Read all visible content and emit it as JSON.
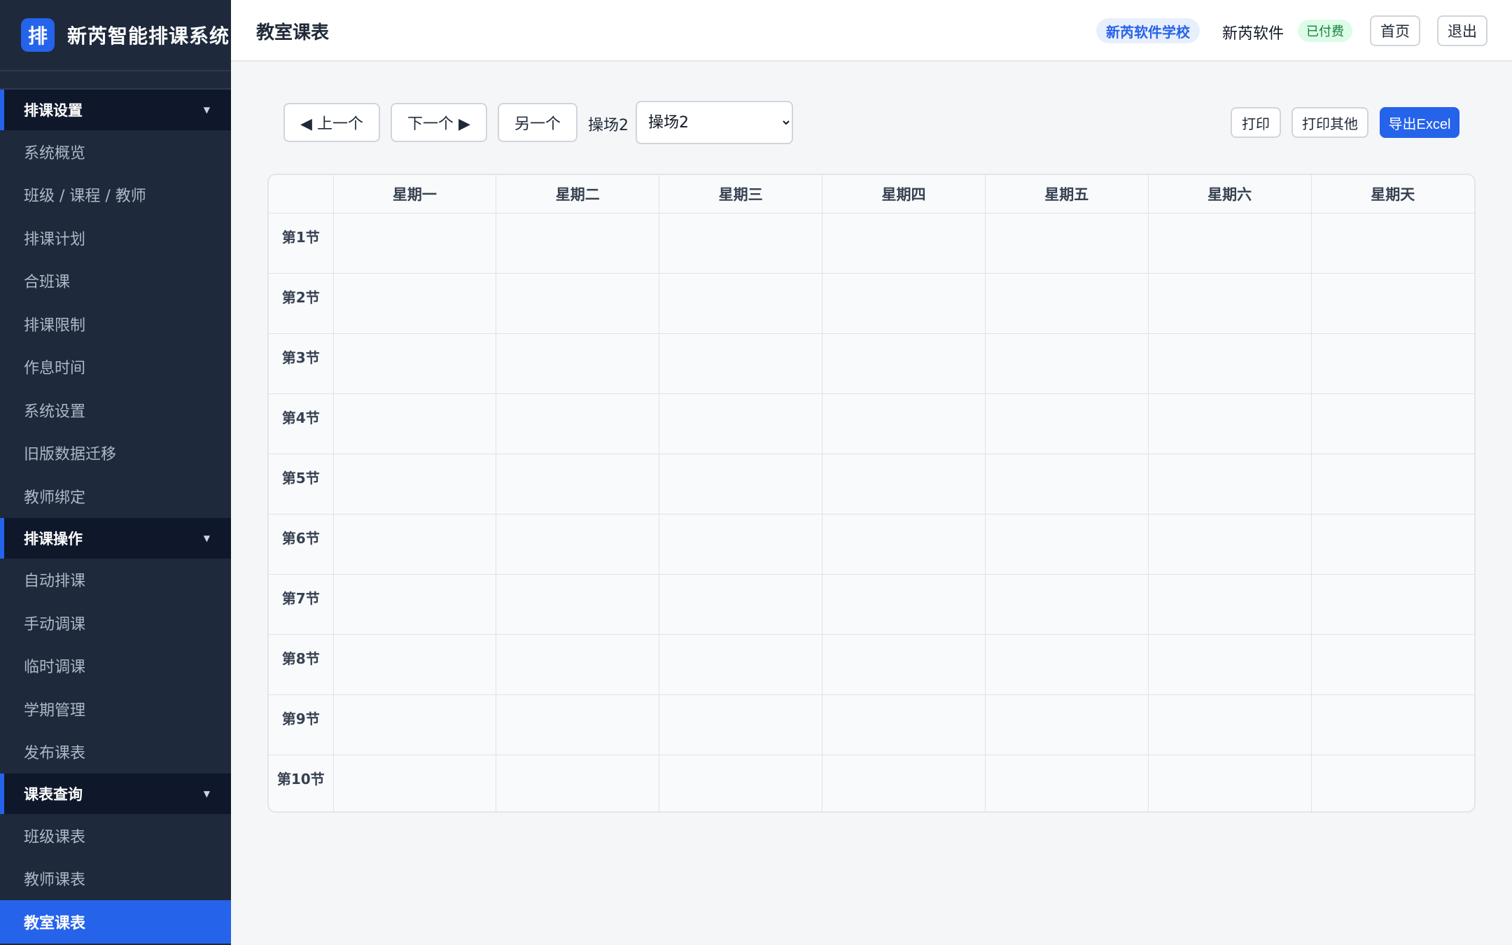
{
  "brand": {
    "logo": "排",
    "title": "新芮智能排课系统"
  },
  "sidebar": {
    "groups": [
      {
        "label": "排课设置",
        "items": [
          "系统概览",
          "班级 / 课程 / 教师",
          "排课计划",
          "合班课",
          "排课限制",
          "作息时间",
          "系统设置",
          "旧版数据迁移",
          "教师绑定"
        ]
      },
      {
        "label": "排课操作",
        "items": [
          "自动排课",
          "手动调课",
          "临时调课",
          "学期管理",
          "发布课表"
        ]
      },
      {
        "label": "课表查询",
        "items": [
          "班级课表",
          "教师课表",
          "教室课表"
        ]
      }
    ],
    "active_item": "教室课表"
  },
  "header": {
    "title": "教室课表",
    "school": "新芮软件学校",
    "user": "新芮软件",
    "paid_badge": "已付费",
    "home": "首页",
    "logout": "退出"
  },
  "toolbar": {
    "prev": "◀ 上一个",
    "next": "下一个 ▶",
    "another": "另一个",
    "room_label": "操场2",
    "room_selected": "操场2",
    "print": "打印",
    "print_other": "打印其他",
    "export": "导出Excel"
  },
  "timetable": {
    "days": [
      "星期一",
      "星期二",
      "星期三",
      "星期四",
      "星期五",
      "星期六",
      "星期天"
    ],
    "periods": [
      "第1节",
      "第2节",
      "第3节",
      "第4节",
      "第5节",
      "第6节",
      "第7节",
      "第8节",
      "第9节",
      "第10节"
    ]
  },
  "colors": {
    "accent": "#2563eb",
    "sidebar_bg": "#1e293b",
    "group_bg": "#0f172a",
    "paid": "#15803d"
  }
}
